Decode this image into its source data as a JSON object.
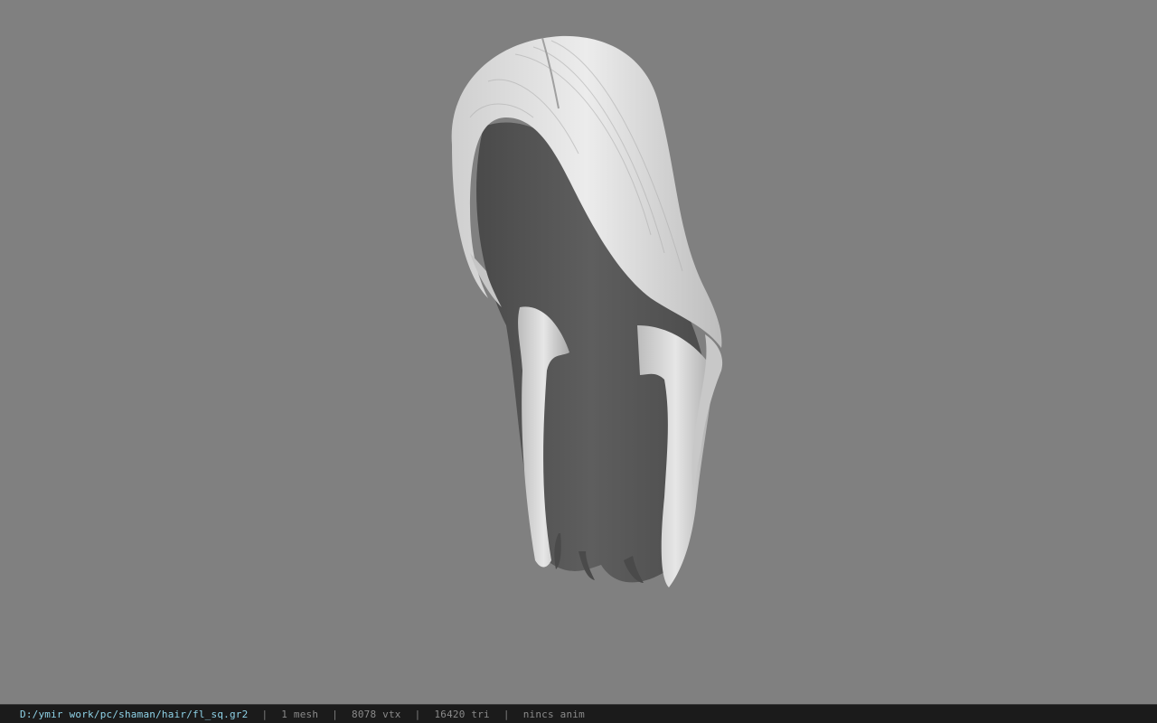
{
  "viewport": {
    "background": "#808080",
    "model_icon": "hair-mesh"
  },
  "statusbar": {
    "file_path": "D:/ymir work/pc/shaman/hair/fl_sq.gr2",
    "separator": "|",
    "mesh_count": "1 mesh",
    "vertex_count": "8078 vtx",
    "triangle_count": "16420 tri",
    "animation": "nincs anim",
    "path_color": "#8fd3e8",
    "text_color": "#8a8a8a"
  }
}
